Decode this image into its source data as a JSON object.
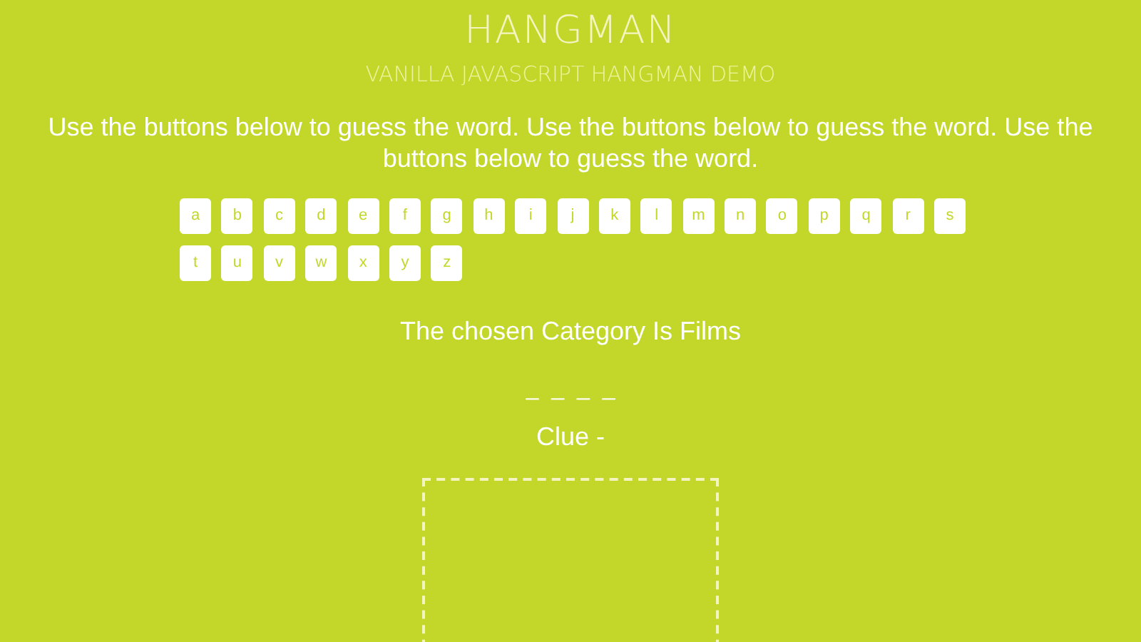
{
  "title": "HANGMAN",
  "subtitle": "VANILLA JAVASCRIPT HANGMAN DEMO",
  "instructions": "Use the buttons below to guess the word. Use the buttons below to guess the word. Use the buttons below to guess the word.",
  "letters": [
    "a",
    "b",
    "c",
    "d",
    "e",
    "f",
    "g",
    "h",
    "i",
    "j",
    "k",
    "l",
    "m",
    "n",
    "o",
    "p",
    "q",
    "r",
    "s",
    "t",
    "u",
    "v",
    "w",
    "x",
    "y",
    "z"
  ],
  "category": "The chosen Category Is Films",
  "word_slots": [
    "_",
    "_",
    "_",
    "_"
  ],
  "clue": "Clue -"
}
